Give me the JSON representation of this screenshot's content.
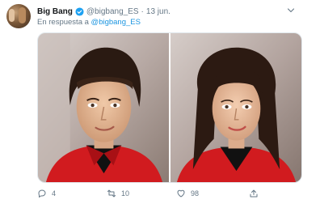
{
  "tweet": {
    "author_name": "Big Bang",
    "handle": "@bigbang_ES",
    "separator": "·",
    "date": "13 jun.",
    "reply_prefix": "En respuesta a",
    "reply_to": "@bigbang_ES",
    "verified": true
  },
  "media": {
    "photos": [
      {
        "subject": "man-with-bowl-haircut-red-shirt"
      },
      {
        "subject": "woman-with-long-hair-red-shirt"
      }
    ]
  },
  "actions": {
    "replies": "4",
    "retweets": "10",
    "likes": "98"
  },
  "colors": {
    "accent": "#1b95e0",
    "muted": "#657786",
    "text": "#14171a"
  },
  "icons": [
    "verified-icon",
    "caret-down-icon",
    "reply-icon",
    "retweet-icon",
    "like-icon",
    "share-icon"
  ]
}
